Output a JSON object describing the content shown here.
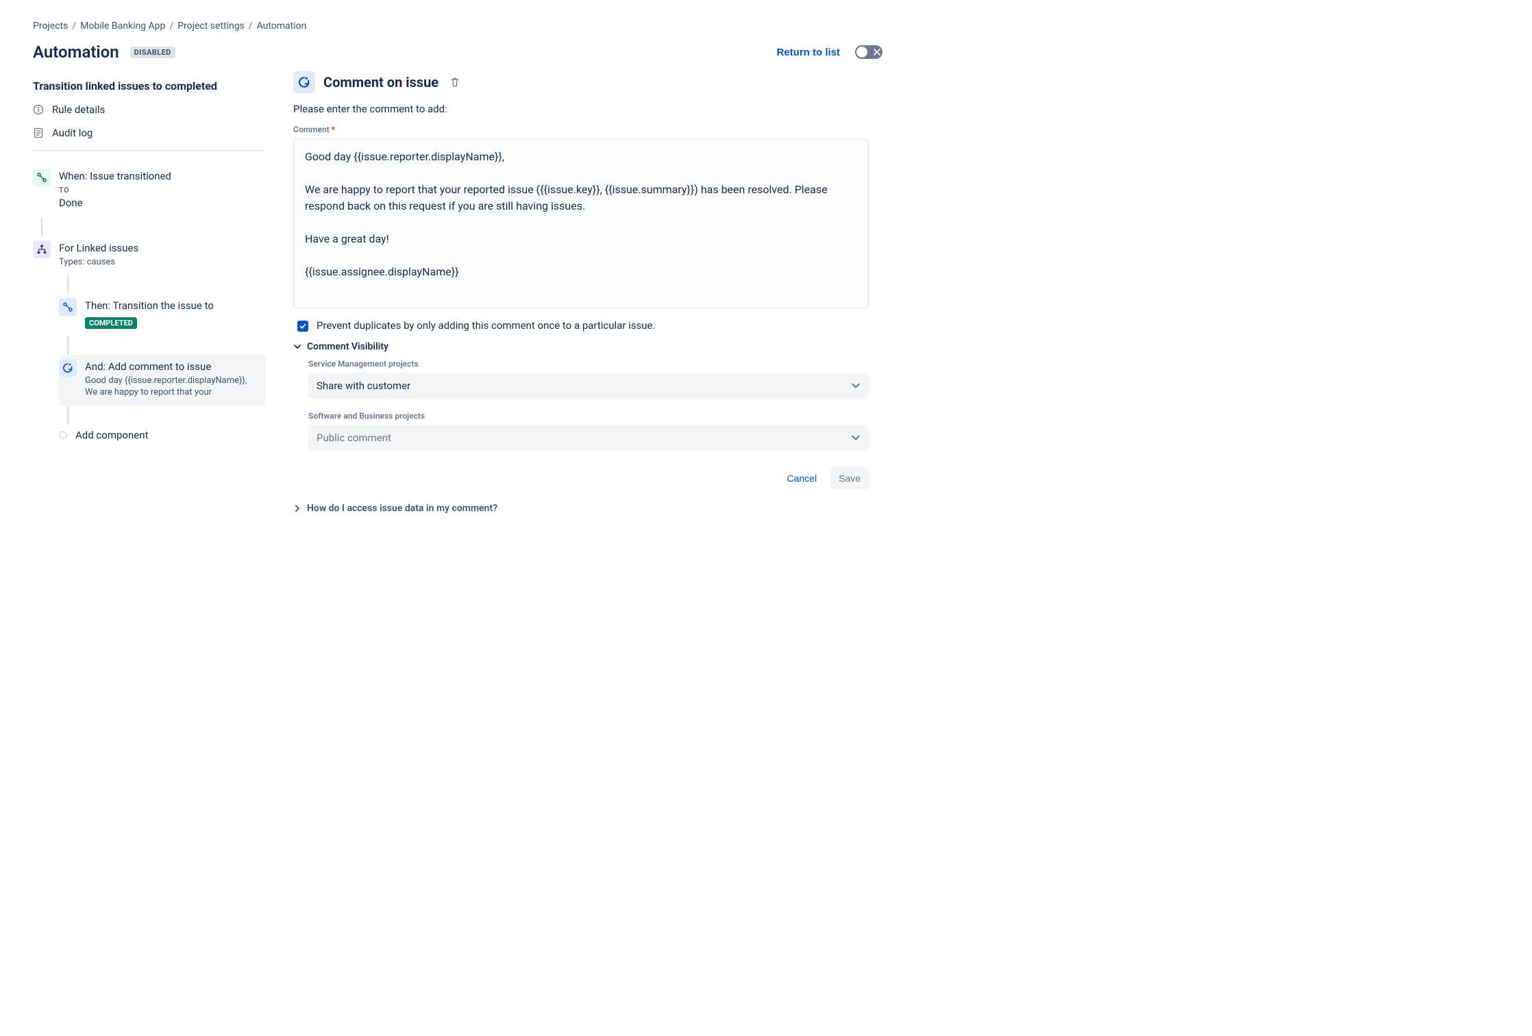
{
  "breadcrumb": {
    "items": [
      "Projects",
      "Mobile Banking App",
      "Project settings",
      "Automation"
    ]
  },
  "header": {
    "title": "Automation",
    "badge": "DISABLED",
    "returnLabel": "Return to list"
  },
  "leftPanel": {
    "title": "Transition linked issues to completed",
    "sideItems": [
      {
        "icon": "info",
        "label": "Rule details"
      },
      {
        "icon": "log",
        "label": "Audit log"
      }
    ],
    "chain": {
      "trigger": {
        "title": "When: Issue transitioned",
        "subLabel": "TO",
        "sub": "Done"
      },
      "branch": {
        "title": "For Linked issues",
        "sub": "Types: causes"
      },
      "transition": {
        "title": "Then: Transition the issue to",
        "badge": "COMPLETED"
      },
      "comment": {
        "title": "And: Add comment to issue",
        "sub": "Good day {{issue.reporter.displayName}}, We are happy to report that your"
      },
      "addComponent": "Add component"
    }
  },
  "rightPanel": {
    "title": "Comment on issue",
    "helper": "Please enter the comment to add:",
    "commentField": {
      "label": "Comment",
      "value": "Good day {{issue.reporter.displayName}},\n\nWe are happy to report that your reported issue ({{issue.key}}, {{issue.summary}}) has been resolved. Please respond back on this request if you are still having issues.\n\nHave a great day!\n\n{{issue.assignee.displayName}}"
    },
    "preventDup": {
      "checked": true,
      "label": "Prevent duplicates by only adding this comment once to a particular issue."
    },
    "visibility": {
      "title": "Comment Visibility",
      "sm": {
        "label": "Service Management projects",
        "value": "Share with customer"
      },
      "sw": {
        "label": "Software and Business projects",
        "value": "Public comment"
      }
    },
    "helpLink": "How do I access issue data in my comment?",
    "buttons": {
      "cancel": "Cancel",
      "save": "Save"
    }
  }
}
